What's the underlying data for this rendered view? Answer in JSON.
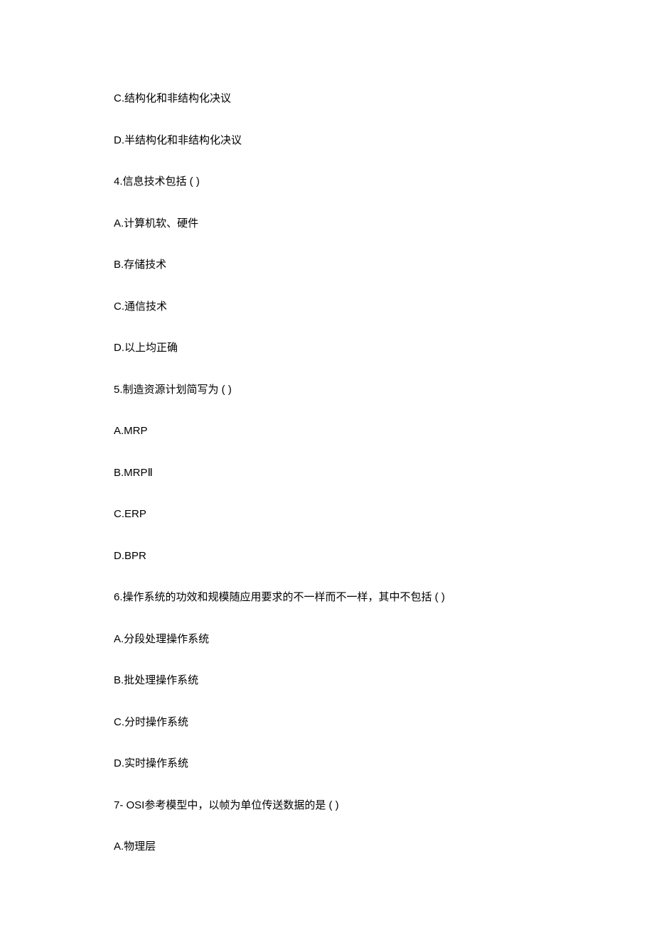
{
  "lines": [
    "C.结构化和非结构化决议",
    "D.半结构化和非结构化决议",
    "4.信息技术包括 ( )",
    "A.计算机软、硬件",
    "B.存储技术",
    "C.通信技术",
    "D.以上均正确",
    "5.制造资源计划简写为 ( )",
    "A.MRP",
    "B.MRPⅡ",
    "C.ERP",
    "D.BPR",
    "6.操作系统的功效和规模随应用要求的不一样而不一样，其中不包括 ( )",
    "A.分段处理操作系统",
    "B.批处理操作系统",
    "C.分时操作系统",
    "D.实时操作系统",
    "7- OSI参考模型中，以帧为单位传送数据的是 ( )",
    "A.物理层"
  ]
}
